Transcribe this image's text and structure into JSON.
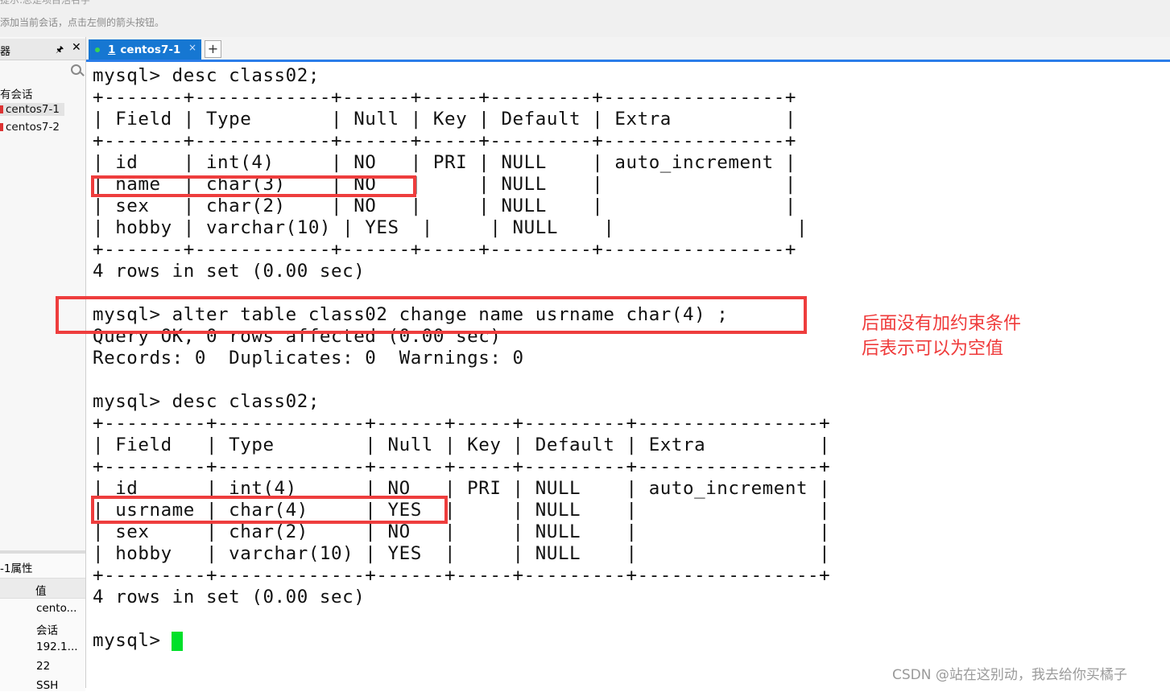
{
  "toolbar": {
    "ghost_text": "提示:总是项目活名字",
    "hint": "添加当前会话，点击左侧的箭头按钮。"
  },
  "sidebar": {
    "title": "器",
    "pin_icon": "pin-icon",
    "close_icon": "close-icon",
    "search_icon": "search-icon",
    "tree": [
      {
        "label": "有会话"
      },
      {
        "label": "centos7-1"
      },
      {
        "label": "centos7-2"
      }
    ]
  },
  "properties": {
    "title": "-1属性",
    "value_header": "值",
    "values": [
      "cento...",
      "会话",
      "192.1...",
      "22",
      "SSH"
    ]
  },
  "tabs": [
    {
      "number": "1",
      "label": "centos7-1",
      "close": "×",
      "status_color": "#39d353"
    }
  ],
  "add_tab": "+",
  "terminal": {
    "lines": [
      "mysql> desc class02;",
      "+-------+------------+------+-----+---------+----------------+",
      "| Field | Type       | Null | Key | Default | Extra          |",
      "+-------+------------+------+-----+---------+----------------+",
      "| id    | int(4)     | NO   | PRI | NULL    | auto_increment |",
      "| name  | char(3)    | NO   |     | NULL    |                |",
      "| sex   | char(2)    | NO   |     | NULL    |                |",
      "| hobby | varchar(10) | YES  |     | NULL    |                |",
      "+-------+------------+------+-----+---------+----------------+",
      "4 rows in set (0.00 sec)",
      "",
      "mysql> alter table class02 change name usrname char(4) ;",
      "Query OK, 0 rows affected (0.00 sec)",
      "Records: 0  Duplicates: 0  Warnings: 0",
      "",
      "mysql> desc class02;",
      "+---------+-------------+------+-----+---------+----------------+",
      "| Field   | Type        | Null | Key | Default | Extra          |",
      "+---------+-------------+------+-----+---------+----------------+",
      "| id      | int(4)      | NO   | PRI | NULL    | auto_increment |",
      "| usrname | char(4)     | YES  |     | NULL    |                |",
      "| sex     | char(2)     | NO   |     | NULL    |                |",
      "| hobby   | varchar(10) | YES  |     | NULL    |                |",
      "+---------+-------------+------+-----+---------+----------------+",
      "4 rows in set (0.00 sec)",
      "",
      "mysql> "
    ],
    "cursor_color": "#00e02a"
  },
  "annotation": {
    "line1": "后面没有加约束条件",
    "line2": "后表示可以为空值",
    "color": "#ef3a3a"
  },
  "watermark": "CSDN @站在这别动，我去给你买橘子"
}
